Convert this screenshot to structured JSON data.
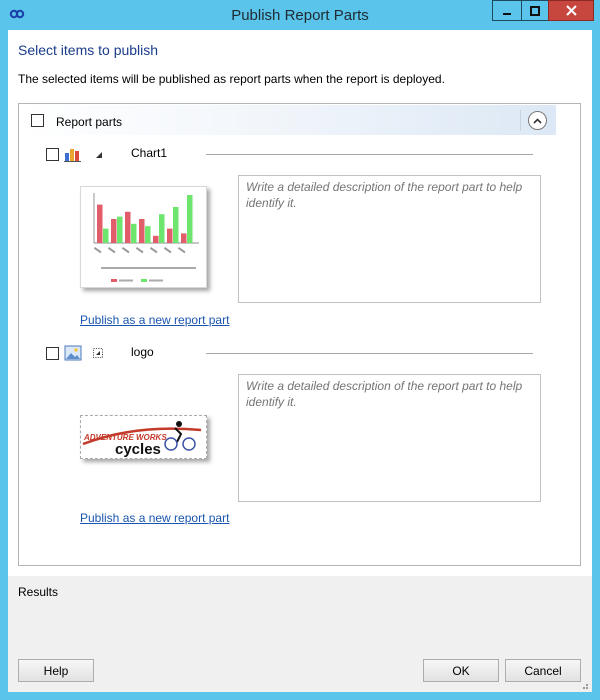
{
  "window": {
    "title": "Publish Report Parts"
  },
  "page": {
    "heading": "Select items to publish",
    "subtext": "The selected items will be published as report parts when the report is deployed."
  },
  "group": {
    "label": "Report parts",
    "checked": false
  },
  "items": [
    {
      "name": "Chart1",
      "icon": "bar-chart-icon",
      "checked": false,
      "description_placeholder": "Write a detailed description of the report part to help identify it.",
      "link_label": "Publish as a new report part",
      "chart_data": {
        "type": "bar",
        "series": [
          {
            "name": "",
            "color": "#e25d6a",
            "values": [
              8,
              5,
              6.5,
              5,
              1.5,
              3,
              2
            ]
          },
          {
            "name": "",
            "color": "#6ee66e",
            "values": [
              3,
              5.5,
              4,
              3.5,
              6,
              7.5,
              10
            ]
          }
        ]
      }
    },
    {
      "name": "logo",
      "icon": "image-icon",
      "checked": false,
      "description_placeholder": "Write a detailed description of the report part to help identify it.",
      "link_label": "Publish as a new report part",
      "logo_text": {
        "line1": "ADVENTURE WORKS",
        "line2": "cycles"
      }
    }
  ],
  "footer": {
    "results_label": "Results",
    "help_label": "Help",
    "ok_label": "OK",
    "cancel_label": "Cancel"
  },
  "colors": {
    "titlebar": "#5bc4ea",
    "heading": "#1a3c8a",
    "link": "#1a56b0",
    "close": "#c7473f"
  }
}
